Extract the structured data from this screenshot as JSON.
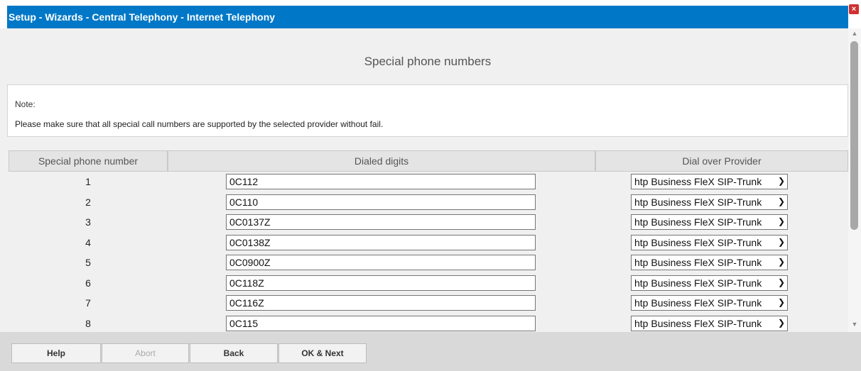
{
  "window": {
    "title": "Setup - Wizards - Central Telephony - Internet Telephony",
    "close_glyph": "×"
  },
  "page": {
    "heading": "Special phone numbers"
  },
  "note": {
    "label": "Note:",
    "text": "Please make sure that all special call numbers are supported by the selected provider without fail."
  },
  "table": {
    "headers": [
      "Special phone number",
      "Dialed digits",
      "Dial over Provider"
    ],
    "rows": [
      {
        "number": "1",
        "digits": "0C112",
        "provider": "htp Business FleX SIP-Trunk"
      },
      {
        "number": "2",
        "digits": "0C110",
        "provider": "htp Business FleX SIP-Trunk"
      },
      {
        "number": "3",
        "digits": "0C0137Z",
        "provider": "htp Business FleX SIP-Trunk"
      },
      {
        "number": "4",
        "digits": "0C0138Z",
        "provider": "htp Business FleX SIP-Trunk"
      },
      {
        "number": "5",
        "digits": "0C0900Z",
        "provider": "htp Business FleX SIP-Trunk"
      },
      {
        "number": "6",
        "digits": "0C118Z",
        "provider": "htp Business FleX SIP-Trunk"
      },
      {
        "number": "7",
        "digits": "0C116Z",
        "provider": "htp Business FleX SIP-Trunk"
      },
      {
        "number": "8",
        "digits": "0C115",
        "provider": "htp Business FleX SIP-Trunk"
      }
    ]
  },
  "footer": {
    "help": "Help",
    "abort": "Abort",
    "back": "Back",
    "ok_next": "OK & Next"
  },
  "icons": {
    "close": "close-icon",
    "chevron": "chevron-down-icon",
    "scroll_up": "scroll-up-icon",
    "scroll_down": "scroll-down-icon"
  },
  "colors": {
    "titlebar": "#0078c7",
    "close": "#d03030"
  }
}
